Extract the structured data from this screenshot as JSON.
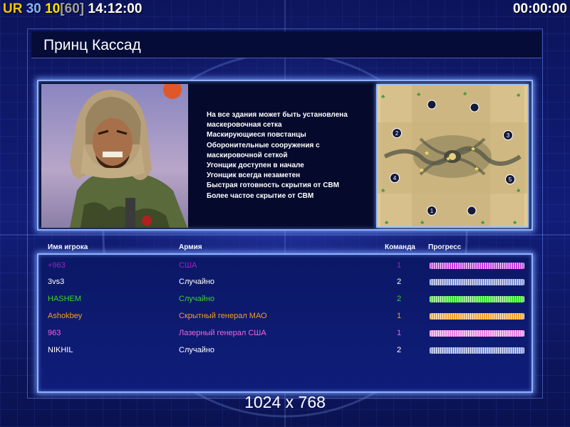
{
  "hud": {
    "ur": "UR",
    "n30": "30",
    "n10": "10",
    "n60": "[60]",
    "clock": "14:12:00",
    "timer": "00:00:00"
  },
  "title": "Принц Кассад",
  "features": [
    "На все здания может быть установлена",
    " маскеровочная сетка",
    "Маскирующиеся повстанцы",
    "Оборонительные сооружения с",
    " маскировочной сеткой",
    "Угонщик доступен в начале",
    "Угонщик всегда незаметен",
    "Быстрая готовность скрытия от СВМ",
    "Более частое скрытие от СВМ"
  ],
  "minimap": {
    "start_positions": [
      "1",
      "2",
      "3",
      "4",
      "5"
    ]
  },
  "columns": {
    "name": "Имя игрока",
    "army": "Армия",
    "team": "Команда",
    "progress": "Прогресс"
  },
  "players": [
    {
      "name": "+963",
      "army": "США",
      "team": "1",
      "color": "#a020c0",
      "progress": 1.0
    },
    {
      "name": "3vs3",
      "army": "Случайно",
      "team": "2",
      "color": "#ffffff",
      "progress": 1.0
    },
    {
      "name": "HASHEM",
      "army": "Случайно",
      "team": "2",
      "color": "#3fd22a",
      "progress": 1.0
    },
    {
      "name": "Ashokbey",
      "army": "Скрытный генерал МАО",
      "team": "1",
      "color": "#f0a020",
      "progress": 1.0
    },
    {
      "name": "963",
      "army": "Лазерный генерал США",
      "team": "1",
      "color": "#ee66dd",
      "progress": 1.0
    },
    {
      "name": "NIKHIL",
      "army": "Случайно",
      "team": "2",
      "color": "#ffffff",
      "progress": 1.0
    }
  ],
  "bar_colors": [
    "#c040e0",
    "#8090d0",
    "#40e030",
    "#f0a030",
    "#f080e0",
    "#8090d0"
  ],
  "resolution": "1024 x 768"
}
